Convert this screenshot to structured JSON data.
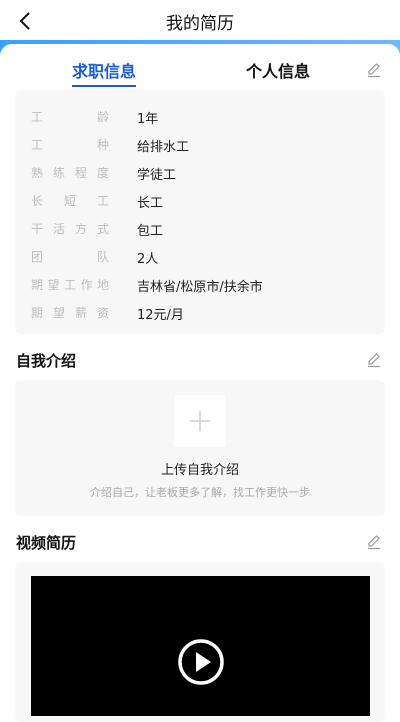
{
  "header": {
    "title": "我的简历",
    "back_icon": "chevron-left-icon"
  },
  "tabs": [
    {
      "label": "求职信息",
      "active": true
    },
    {
      "label": "个人信息",
      "active": false
    }
  ],
  "job_info": [
    {
      "label": "工龄",
      "value": "1年"
    },
    {
      "label": "工种",
      "value": "给排水工"
    },
    {
      "label": "熟练程度",
      "value": "学徒工"
    },
    {
      "label": "长短工",
      "value": "长工"
    },
    {
      "label": "干活方式",
      "value": "包工"
    },
    {
      "label": "团队",
      "value": "2人"
    },
    {
      "label": "期望工作地",
      "value": "吉林省/松原市/扶余市"
    },
    {
      "label": "期望薪资",
      "value": "12元/月"
    }
  ],
  "self_intro": {
    "title": "自我介绍",
    "upload_label": "上传自我介绍",
    "upload_hint": "介绍自己，让老板更多了解，找工作更快一步",
    "upload_icon": "plus-icon"
  },
  "video_resume": {
    "title": "视频简历",
    "play_icon": "play-icon"
  },
  "colors": {
    "accent": "#1a5bd6",
    "header_band": "#3aa0ff",
    "card_bg": "#f7f7f7",
    "label_gray": "#bdbdbd"
  }
}
